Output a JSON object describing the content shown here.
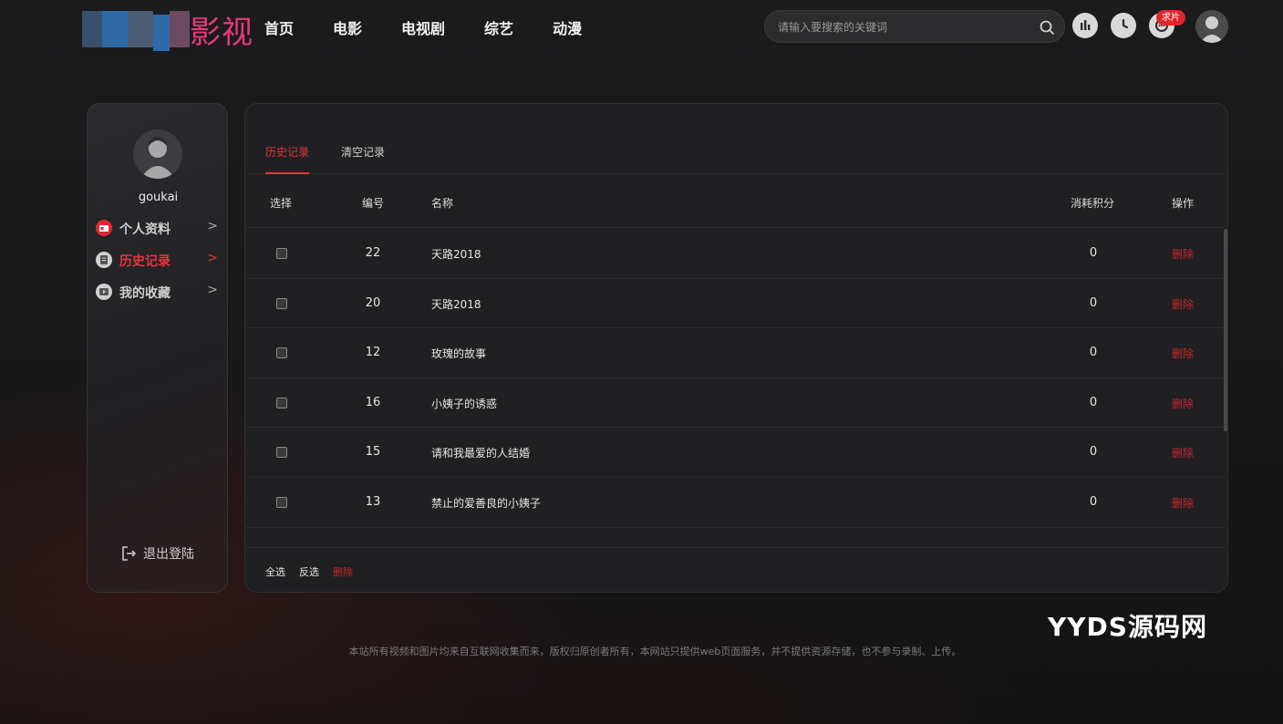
{
  "header": {
    "logo_text": "影视",
    "nav": [
      "首页",
      "电影",
      "电视剧",
      "综艺",
      "动漫"
    ],
    "search_placeholder": "请输入要搜索的关键词",
    "request_badge": "求片"
  },
  "sidebar": {
    "username": "goukai",
    "items": [
      {
        "label": "个人资料",
        "icon": "id-card-icon",
        "color": "#e0262c"
      },
      {
        "label": "历史记录",
        "icon": "history-doc-icon",
        "color": "#cfcfcf"
      },
      {
        "label": "我的收藏",
        "icon": "favorite-video-icon",
        "color": "#cfcfcf"
      }
    ],
    "logout_label": "退出登陆"
  },
  "panel": {
    "tabs": [
      "历史记录",
      "清空记录"
    ],
    "columns": [
      "选择",
      "编号",
      "名称",
      "消耗积分",
      "操作"
    ],
    "rows": [
      {
        "id": "22",
        "name": "天路2018",
        "points": "0",
        "action": "删除"
      },
      {
        "id": "20",
        "name": "天路2018",
        "points": "0",
        "action": "删除"
      },
      {
        "id": "12",
        "name": "玫瑰的故事",
        "points": "0",
        "action": "删除"
      },
      {
        "id": "16",
        "name": "小姨子的诱惑",
        "points": "0",
        "action": "删除"
      },
      {
        "id": "15",
        "name": "请和我最爱的人结婚",
        "points": "0",
        "action": "删除"
      },
      {
        "id": "13",
        "name": "禁止的爱善良的小姨子",
        "points": "0",
        "action": "删除"
      }
    ],
    "footer": {
      "select_all": "全选",
      "invert": "反选",
      "delete": "删除"
    }
  },
  "watermark": "YYDS源码网",
  "copyright": "本站所有视频和图片均来自互联网收集而来，版权归原创者所有，本网站只提供web页面服务，并不提供资源存储，也不参与录制、上传。",
  "colors": {
    "accent": "#e8353b",
    "background": "#161617",
    "panel": "#202022"
  }
}
